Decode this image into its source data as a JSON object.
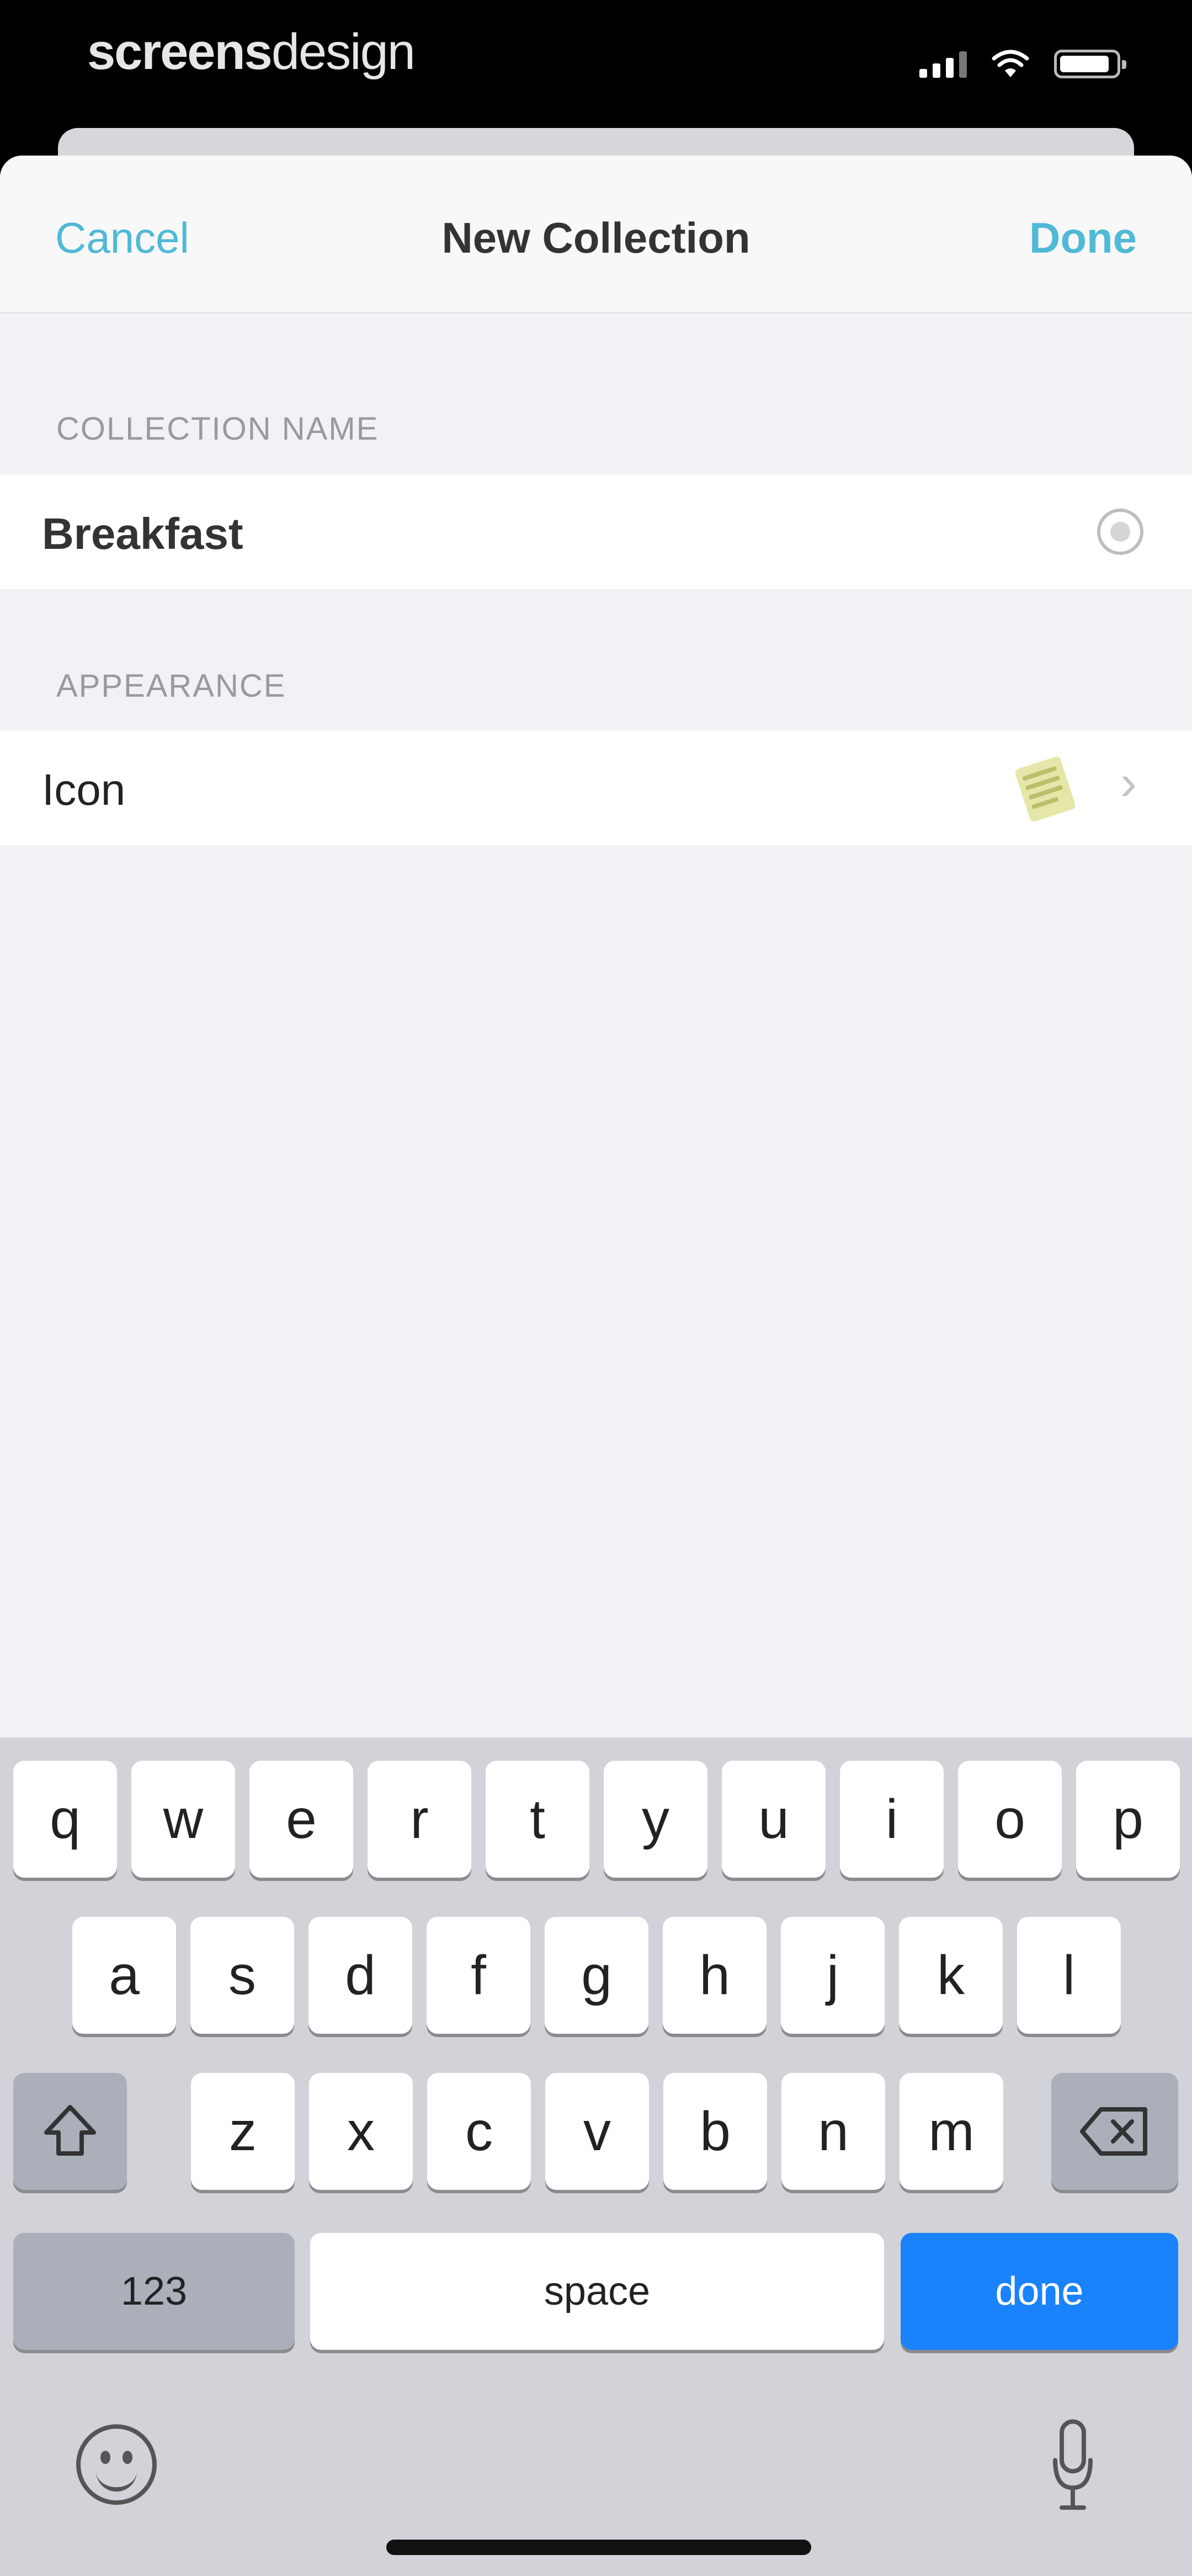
{
  "status_bar": {
    "brand_bold": "screens",
    "brand_light": "design",
    "icons": [
      "signal-icon",
      "wifi-icon",
      "battery-icon"
    ]
  },
  "navbar": {
    "cancel_label": "Cancel",
    "title": "New Collection",
    "done_label": "Done"
  },
  "form": {
    "name_section_label": "COLLECTION NAME",
    "name_value": "Breakfast",
    "appearance_section_label": "APPEARANCE",
    "icon_row_label": "Icon"
  },
  "keyboard": {
    "row1": [
      "q",
      "w",
      "e",
      "r",
      "t",
      "y",
      "u",
      "i",
      "o",
      "p"
    ],
    "row2": [
      "a",
      "s",
      "d",
      "f",
      "g",
      "h",
      "j",
      "k",
      "l"
    ],
    "row3": [
      "z",
      "x",
      "c",
      "v",
      "b",
      "n",
      "m"
    ],
    "numbers_label": "123",
    "space_label": "space",
    "return_label": "done"
  },
  "colors": {
    "accent": "#4fb9d6",
    "return_key": "#1a82fb",
    "keyboard_bg": "#d1d3d9",
    "background": "#f2f2f6"
  }
}
